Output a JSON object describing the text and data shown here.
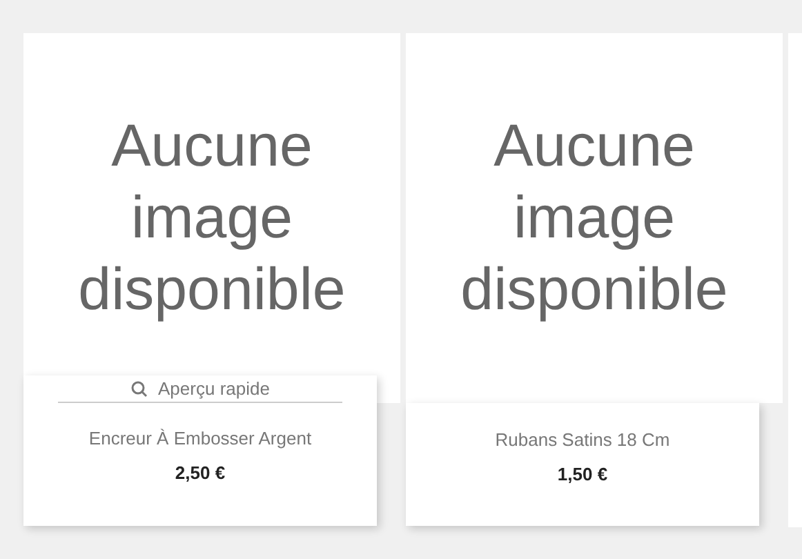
{
  "products": [
    {
      "image_text": "Aucune image disponible",
      "name": "Encreur À Embosser Argent",
      "price": "2,50 €",
      "hovered": true,
      "quick_view": "Aperçu rapide"
    },
    {
      "image_text": "Aucune image disponible",
      "name": "Rubans Satins 18 Cm",
      "price": "1,50 €",
      "hovered": false
    }
  ]
}
